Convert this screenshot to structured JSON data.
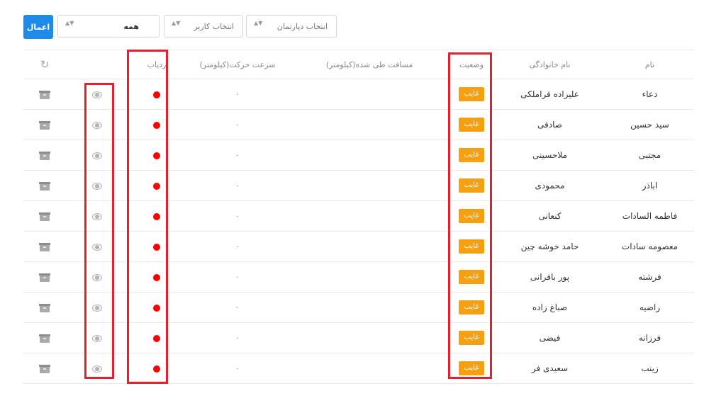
{
  "filters": {
    "apply_label": "اعمال",
    "all_value": "همه",
    "user_placeholder": "انتخاب کاربر",
    "department_placeholder": "انتخاب دپارتمان",
    "arrow_glyph": "▲▼"
  },
  "colors": {
    "accent": "#1f8be8",
    "status_absent": "#f5a011",
    "tracking_dot": "#ff0000",
    "highlight": "#e3202b"
  },
  "table": {
    "headers": {
      "name": "نام",
      "family": "نام خانوادگی",
      "status": "وضعیت",
      "distance": "مسافت طی شده(کیلومتر)",
      "speed": "سرعت حرکت(کیلومتر)",
      "tracking": "ردیاب",
      "view": "",
      "refresh_glyph": "↻"
    },
    "rows": [
      {
        "name": "دعاء",
        "family": "علیزاده قراملکی",
        "status": "غایب",
        "distance": "",
        "speed": "۰"
      },
      {
        "name": "سید حسین",
        "family": "صادقی",
        "status": "غایب",
        "distance": "",
        "speed": "۰"
      },
      {
        "name": "مجتبی",
        "family": "ملاحسینی",
        "status": "غایب",
        "distance": "",
        "speed": "۰"
      },
      {
        "name": "اباذر",
        "family": "محمودی",
        "status": "غایب",
        "distance": "",
        "speed": "۰"
      },
      {
        "name": "فاطمه السادات",
        "family": "کنعانی",
        "status": "غایب",
        "distance": "",
        "speed": "۰"
      },
      {
        "name": "معصومه سادات",
        "family": "حامد خوشه چین",
        "status": "غایب",
        "distance": "",
        "speed": "۰"
      },
      {
        "name": "فرشته",
        "family": "پور بافرانی",
        "status": "غایب",
        "distance": "",
        "speed": "۰"
      },
      {
        "name": "راضیه",
        "family": "صباغ زاده",
        "status": "غایب",
        "distance": "",
        "speed": "۰"
      },
      {
        "name": "فرزانه",
        "family": "فیضی",
        "status": "غایب",
        "distance": "",
        "speed": "۰"
      },
      {
        "name": "زینب",
        "family": "سعیدی فر",
        "status": "غایب",
        "distance": "",
        "speed": "۰"
      }
    ]
  },
  "icons": {
    "refresh": "refresh-icon",
    "archive": "archive-icon",
    "view": "eye-icon",
    "tracking": "status-dot"
  }
}
